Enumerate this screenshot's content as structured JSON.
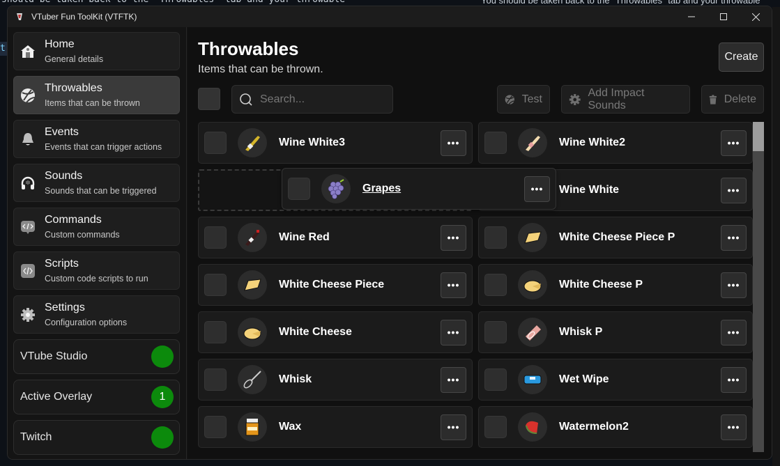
{
  "background": {
    "left_text": "should be taken back to the \"Throwables\" tab and your throwable",
    "right_text": "You should be taken back to the \"Throwables\" tab and your throwable",
    "edge_char": "t"
  },
  "window": {
    "title": "VTuber Fun ToolKit (VTFTK)",
    "controls": [
      "minimize",
      "maximize",
      "close"
    ]
  },
  "sidebar": {
    "items": [
      {
        "label": "Home",
        "sub": "General details",
        "icon": "home-icon",
        "active": false
      },
      {
        "label": "Throwables",
        "sub": "Items that can be thrown",
        "icon": "ball-icon",
        "active": true
      },
      {
        "label": "Events",
        "sub": "Events that can trigger actions",
        "icon": "bell-icon",
        "active": false
      },
      {
        "label": "Sounds",
        "sub": "Sounds that can be triggered",
        "icon": "headphones-icon",
        "active": false
      },
      {
        "label": "Commands",
        "sub": "Custom commands",
        "icon": "code-bubble-icon",
        "active": false
      },
      {
        "label": "Scripts",
        "sub": "Custom code scripts to run",
        "icon": "code-icon",
        "active": false
      },
      {
        "label": "Settings",
        "sub": "Configuration options",
        "icon": "gear-icon",
        "active": false
      }
    ],
    "status": [
      {
        "label": "VTube Studio",
        "value": "",
        "color": "#0c8a0c"
      },
      {
        "label": "Active Overlay",
        "value": "1",
        "color": "#0c8a0c"
      },
      {
        "label": "Twitch",
        "value": "",
        "color": "#0c8a0c"
      }
    ]
  },
  "main": {
    "title": "Throwables",
    "subtitle": "Items that can be thrown.",
    "create_label": "Create",
    "search_placeholder": "Search...",
    "test_label": "Test",
    "impact_label": "Add Impact Sounds",
    "delete_label": "Delete",
    "more_label": "•••",
    "items": [
      {
        "name": "Wine White3",
        "thumb": "wine-white-bottle"
      },
      {
        "name": "Wine White2",
        "thumb": "wine-white-bottle-2"
      },
      {
        "name": "",
        "thumb": "",
        "drop_placeholder": true
      },
      {
        "name": "Wine White",
        "thumb": "wine-white-bottle"
      },
      {
        "name": "Wine Red",
        "thumb": "wine-red-bottle"
      },
      {
        "name": "White Cheese Piece P",
        "thumb": "cheese-piece"
      },
      {
        "name": "White Cheese Piece",
        "thumb": "cheese-piece"
      },
      {
        "name": "White Cheese P",
        "thumb": "cheese-wheel"
      },
      {
        "name": "White Cheese",
        "thumb": "cheese-wheel"
      },
      {
        "name": "Whisk P",
        "thumb": "whisk-wrapped"
      },
      {
        "name": "Whisk",
        "thumb": "whisk"
      },
      {
        "name": "Wet Wipe",
        "thumb": "wet-wipe"
      },
      {
        "name": "Wax",
        "thumb": "wax-jar"
      },
      {
        "name": "Watermelon2",
        "thumb": "watermelon"
      }
    ],
    "dragging_item": {
      "name": "Grapes",
      "thumb": "grapes"
    }
  }
}
